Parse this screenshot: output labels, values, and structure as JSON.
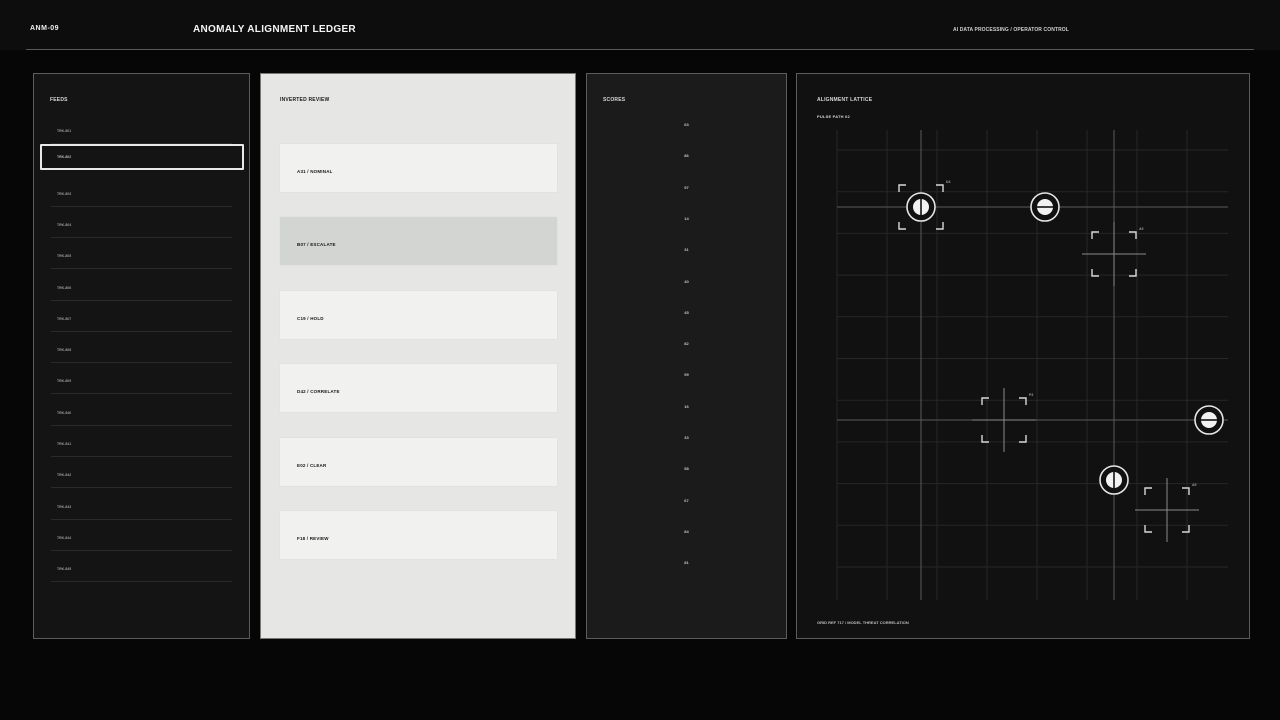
{
  "header": {
    "code": "ANM-09",
    "title": "ANOMALY ALIGNMENT LEDGER",
    "subtitle": "AI DATA PROCESSING / OPERATOR CONTROL"
  },
  "feeds": {
    "label": "FEEDS",
    "items": [
      "TRK-801",
      "TRK-802",
      "TRK-803",
      "TRK-804",
      "TRK-805",
      "TRK-806",
      "TRK-807",
      "TRK-808",
      "TRK-809",
      "TRK-840",
      "TRK-841",
      "TRK-842",
      "TRK-843",
      "TRK-844",
      "TRK-845"
    ],
    "selected_index": 1
  },
  "review": {
    "label": "INVERTED REVIEW",
    "cards": [
      "A31 / NOMINAL",
      "B07 / ESCALATE",
      "C19 / HOLD",
      "D42 / CORRELATE",
      "E02 / CLEAR",
      "F18 / REVIEW"
    ],
    "active_index": 1
  },
  "scores": {
    "label": "SCORES",
    "values": [
      "63",
      "86",
      "97",
      "14",
      "31",
      "40",
      "45",
      "82",
      "99",
      "16",
      "33",
      "58",
      "67",
      "84",
      "81"
    ]
  },
  "lattice": {
    "label": "ALIGNMENT LATTICE",
    "path_label": "PULSE PATH 02",
    "footer": "GRID REF 717 / MODEL THREAT CORRELATION",
    "targets": [
      "D4",
      "A9",
      "P3",
      "A9"
    ]
  },
  "colors": {
    "background": "#060606",
    "panel": "#141414",
    "review_panel": "#e6e7e5",
    "accent": "#f2f2f2"
  }
}
